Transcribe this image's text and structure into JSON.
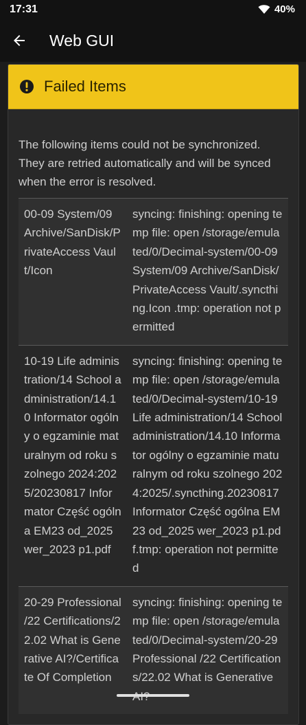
{
  "status_bar": {
    "time": "17:31",
    "battery": "40%",
    "wifi_icon": "wifi-icon"
  },
  "app_bar": {
    "title": "Web GUI",
    "back_icon": "arrow-left-icon"
  },
  "panel": {
    "title": "Failed Items",
    "header_color": "#f0c419",
    "icon": "exclamation-circle-icon",
    "intro": "The following items could not be synchronized. They are retried automatically and will be synced when the error is resolved.",
    "items": [
      {
        "path": "00-09 System/09 Archive/SanDisk/PrivateAccess Vault/Icon",
        "error": "syncing: finishing: opening temp file: open /storage/emulated/0/Decimal-system/00-09 System/09 Archive/SanDisk/PrivateAccess Vault/.syncthing.Icon .tmp: operation not permitted"
      },
      {
        "path": "10-19 Life administration/14 School administration/14.10 Informator ogólny o egzaminie maturalnym od roku szolnego 2024:2025/20230817 Informator Część ogólna EM23 od_2025 wer_2023 p1.pdf",
        "error": "syncing: finishing: opening temp file: open /storage/emulated/0/Decimal-system/10-19 Life administration/14 School administration/14.10 Informator ogólny o egzaminie maturalnym od roku szolnego 2024:2025/.syncthing.20230817 Informator Część ogólna EM23 od_2025 wer_2023 p1.pdf.tmp: operation not permitted"
      },
      {
        "path": "20-29 Professional /22 Certifications/22.02 What is Generative AI?/Certificate Of Completion",
        "error": "syncing: finishing: opening temp file: open /storage/emulated/0/Decimal-system/20-29 Professional /22 Certifications/22.02 What is Generative AI?"
      }
    ]
  }
}
